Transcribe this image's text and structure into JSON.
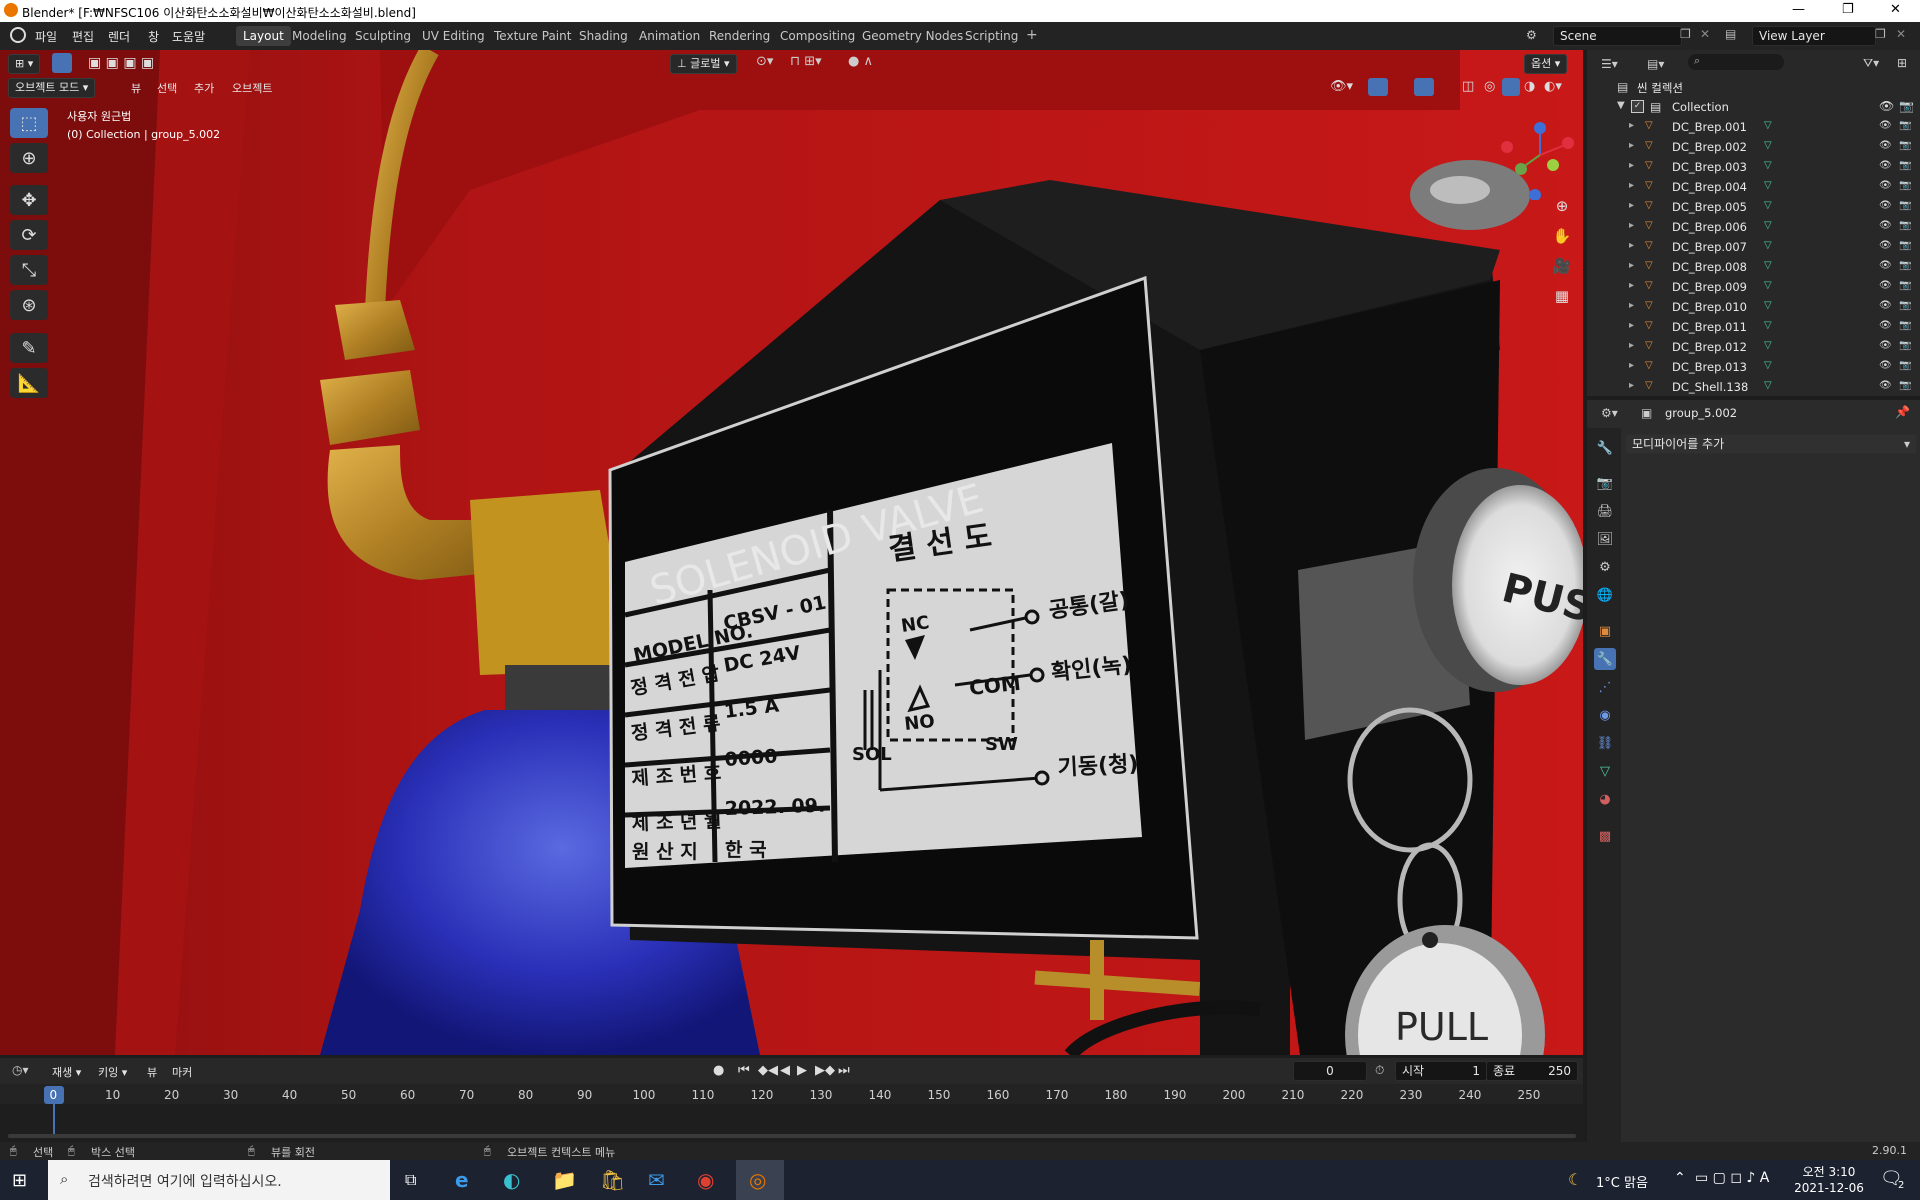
{
  "window": {
    "title": "Blender* [F:₩NFSC106 이산화탄소소화설비₩이산화탄소소화설비.blend]"
  },
  "menus": [
    "파일",
    "편집",
    "렌더",
    "창",
    "도움말"
  ],
  "workspaces": [
    "Layout",
    "Modeling",
    "Sculpting",
    "UV Editing",
    "Texture Paint",
    "Shading",
    "Animation",
    "Rendering",
    "Compositing",
    "Geometry Nodes",
    "Scripting"
  ],
  "scene": {
    "name": "Scene",
    "view_layer": "View Layer"
  },
  "viewport_header": {
    "mode": "오브젝트 모드",
    "menus": [
      "뷰",
      "선택",
      "추가",
      "오브젝트"
    ],
    "orientation": "글로벌",
    "options": "옵션"
  },
  "viewport_info": {
    "view_name": "사용자 원근법",
    "collection_line": "(0) Collection | group_5.002"
  },
  "model": {
    "title": "SOLENOID VALVE",
    "diagram_title": "결 선 도",
    "rows": [
      {
        "label": "MODEL NO.",
        "value": "CBSV - 01"
      },
      {
        "label": "정 격 전 압",
        "value": "DC 24V"
      },
      {
        "label": "정 격 전 류",
        "value": "1.5 A"
      },
      {
        "label": "제 조 번 호",
        "value": "0000"
      },
      {
        "label": "제 조 년 월",
        "value": "2022. 09."
      },
      {
        "label": "원 산 지",
        "value": "한 국"
      }
    ],
    "diagram": {
      "nc": "NC",
      "no": "NO",
      "com": "COM",
      "sol": "SOL",
      "sw": "SW",
      "common": "공통(갈)",
      "confirm": "확인(녹)",
      "start": "기동(청)"
    },
    "push_label": "PUSH",
    "pull_label": "PULL"
  },
  "outliner": {
    "scene_collection": "씬 컬렉션",
    "collection": "Collection",
    "items": [
      "DC_Brep.001",
      "DC_Brep.002",
      "DC_Brep.003",
      "DC_Brep.004",
      "DC_Brep.005",
      "DC_Brep.006",
      "DC_Brep.007",
      "DC_Brep.008",
      "DC_Brep.009",
      "DC_Brep.010",
      "DC_Brep.011",
      "DC_Brep.012",
      "DC_Brep.013",
      "DC_Shell.138"
    ]
  },
  "properties": {
    "object_name": "group_5.002",
    "add_modifier": "모디파이어를 추가"
  },
  "timeline": {
    "menus": [
      "재생",
      "키잉",
      "뷰",
      "마커"
    ],
    "current_frame": "0",
    "start_label": "시작",
    "start": "1",
    "end_label": "종료",
    "end": "250",
    "ticks": [
      "0",
      "10",
      "20",
      "30",
      "40",
      "50",
      "60",
      "70",
      "80",
      "90",
      "100",
      "110",
      "120",
      "130",
      "140",
      "150",
      "160",
      "170",
      "180",
      "190",
      "200",
      "210",
      "220",
      "230",
      "240",
      "250"
    ]
  },
  "statusbar": {
    "select": "선택",
    "box_select": "박스 선택",
    "rotate_view": "뷰를 회전",
    "context_menu": "오브젝트 컨텍스트 메뉴",
    "version": "2.90.1"
  },
  "taskbar": {
    "search_placeholder": "검색하려면 여기에 입력하십시오.",
    "weather": "1°C 맑음",
    "time": "오전 3:10",
    "date": "2021-12-06",
    "notification_count": "2"
  },
  "colors": {
    "accent": "#4772b3",
    "viewport_bg": "#b51515",
    "mesh_icon": "#e08a3c",
    "data_icon": "#4ec9a0"
  }
}
